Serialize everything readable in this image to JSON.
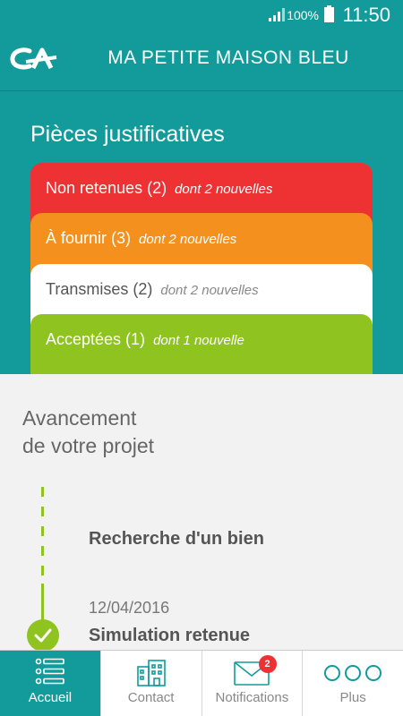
{
  "status_bar": {
    "battery": "100%",
    "time": "11:50"
  },
  "header": {
    "title": "MA PETITE MAISON BLEU"
  },
  "documents": {
    "title": "Pièces justificatives",
    "cards": [
      {
        "label": "Non retenues (2)",
        "sub": "dont 2 nouvelles",
        "color": "#ee3234"
      },
      {
        "label": "À fournir (3)",
        "sub": "dont 2 nouvelles",
        "color": "#f4911e"
      },
      {
        "label": "Transmises (2)",
        "sub": "dont 2 nouvelles",
        "color": "#ffffff"
      },
      {
        "label": "Acceptées (1)",
        "sub": "dont 1 nouvelle",
        "color": "#8fc31f"
      }
    ]
  },
  "progress": {
    "title_line1": "Avancement",
    "title_line2": "de votre projet",
    "steps": [
      {
        "title": "Recherche d'un bien",
        "date": ""
      },
      {
        "title": "Simulation retenue",
        "date": "12/04/2016"
      }
    ]
  },
  "nav": {
    "items": [
      {
        "label": "Accueil",
        "icon": "list-icon"
      },
      {
        "label": "Contact",
        "icon": "building-icon"
      },
      {
        "label": "Notifications",
        "icon": "envelope-icon",
        "badge": "2"
      },
      {
        "label": "Plus",
        "icon": "more-icon"
      }
    ]
  },
  "colors": {
    "primary": "#139b9b",
    "red": "#ee3234",
    "orange": "#f4911e",
    "green": "#8fc31f"
  }
}
